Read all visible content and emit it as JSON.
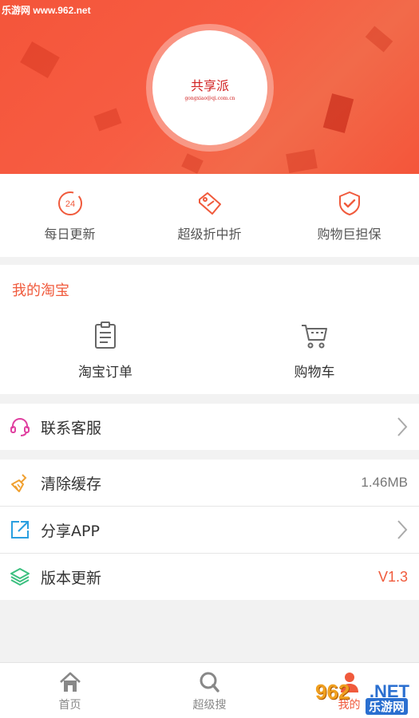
{
  "watermark": "乐游网 www.962.net",
  "header": {
    "avatar_title": "共享派",
    "avatar_subtitle": "gongxiao@qi.com.cn"
  },
  "features": [
    {
      "icon": "clock-24-icon",
      "label": "每日更新"
    },
    {
      "icon": "price-tag-icon",
      "label": "超级折中折"
    },
    {
      "icon": "shield-check-icon",
      "label": "购物巨担保"
    }
  ],
  "my_taobao": {
    "title": "我的淘宝",
    "items": [
      {
        "icon": "clipboard-icon",
        "label": "淘宝订单"
      },
      {
        "icon": "cart-icon",
        "label": "购物车"
      }
    ]
  },
  "rows": {
    "customer_service": {
      "icon": "headset-icon",
      "label": "联系客服"
    },
    "clear_cache": {
      "icon": "broom-icon",
      "label": "清除缓存",
      "value": "1.46MB"
    },
    "share_app": {
      "icon": "share-icon",
      "label": "分享APP"
    },
    "version_update": {
      "icon": "layers-icon",
      "label": "版本更新",
      "value": "V1.3"
    }
  },
  "bottom_nav": [
    {
      "icon": "home-icon",
      "label": "首页"
    },
    {
      "icon": "search-icon",
      "label": "超级搜"
    },
    {
      "icon": "user-icon",
      "label": "我的"
    }
  ],
  "corner_watermark": {
    "num": "962",
    "net": ".NET",
    "name": "乐游网"
  },
  "colors": {
    "accent": "#f05a3c",
    "header_red": "#f4553a",
    "icon_orange": "#f0a030",
    "icon_pink": "#e040a0",
    "icon_blue": "#2a9fe0",
    "icon_green": "#3cc080"
  }
}
